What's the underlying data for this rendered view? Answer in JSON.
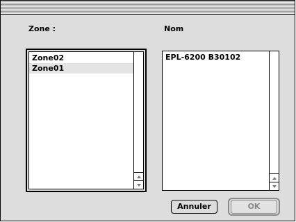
{
  "zone_label": "Zone :",
  "nom_label": "Nom",
  "zones": [
    {
      "name": "Zone02",
      "selected": false
    },
    {
      "name": "Zone01",
      "selected": true
    }
  ],
  "printers": [
    {
      "name": "EPL-6200 B30102"
    }
  ],
  "buttons": {
    "cancel": "Annuler",
    "ok": "OK"
  }
}
